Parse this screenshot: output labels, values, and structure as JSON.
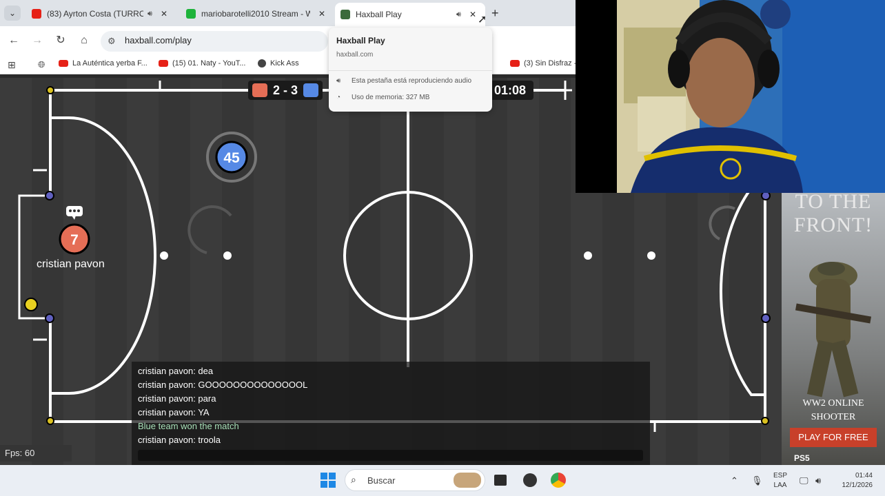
{
  "browser": {
    "tabs": [
      {
        "title": "(83) Ayrton Costa (TURROM",
        "favicon_color": "#e62117",
        "playing_audio": true
      },
      {
        "title": "mariobarotelli2010 Stream - W",
        "favicon_color": "#1eb33b",
        "playing_audio": false
      },
      {
        "title": "Haxball Play",
        "favicon_color": "#3b6b3b",
        "playing_audio": true,
        "active": true
      }
    ],
    "new_tab_label": "+",
    "close_glyph": "✕",
    "url": "haxball.com/play",
    "bookmarks": [
      {
        "label": "La Auténtica yerba F...",
        "color": "#e62117"
      },
      {
        "label": "(15) 01. Naty - YouT...",
        "color": "#e62117"
      },
      {
        "label": "Kick Ass",
        "color": "#444444"
      },
      {
        "label": "(3) Sin Disfraz -",
        "color": "#e62117"
      }
    ]
  },
  "hover_card": {
    "title": "Haxball Play",
    "domain": "haxball.com",
    "audio_note": "Esta pestaña está reproduciendo audio",
    "memory_note": "Uso de memoria: 327 MB"
  },
  "game": {
    "score_red": 2,
    "score_blue": 3,
    "score_text": "2 - 3",
    "timer": "01:08",
    "red_color": "#e56e56",
    "blue_color": "#5689e5",
    "players": [
      {
        "number": "7",
        "team": "red",
        "name": "cristian pavon"
      },
      {
        "number": "45",
        "team": "blue"
      }
    ],
    "fps": "Fps: 60"
  },
  "chat": {
    "lines": [
      {
        "text": "cristian pavon: dea",
        "system": false
      },
      {
        "text": "cristian pavon: GOOOOOOOOOOOOOOL",
        "system": false
      },
      {
        "text": "cristian pavon: para",
        "system": false
      },
      {
        "text": "cristian pavon: YA",
        "system": false
      },
      {
        "text": "Blue team won the match",
        "system": true
      },
      {
        "text": "cristian pavon: troola",
        "system": false
      }
    ]
  },
  "ad": {
    "headline": "TO THE FRONT!",
    "subtitle": "WW2 ONLINE SHOOTER",
    "button": "PLAY FOR FREE",
    "platform": "PS5"
  },
  "taskbar": {
    "search_placeholder": "Buscar",
    "lang_top": "ESP",
    "lang_bottom": "LAA",
    "time": "01:44",
    "date": "12/1/2026"
  }
}
